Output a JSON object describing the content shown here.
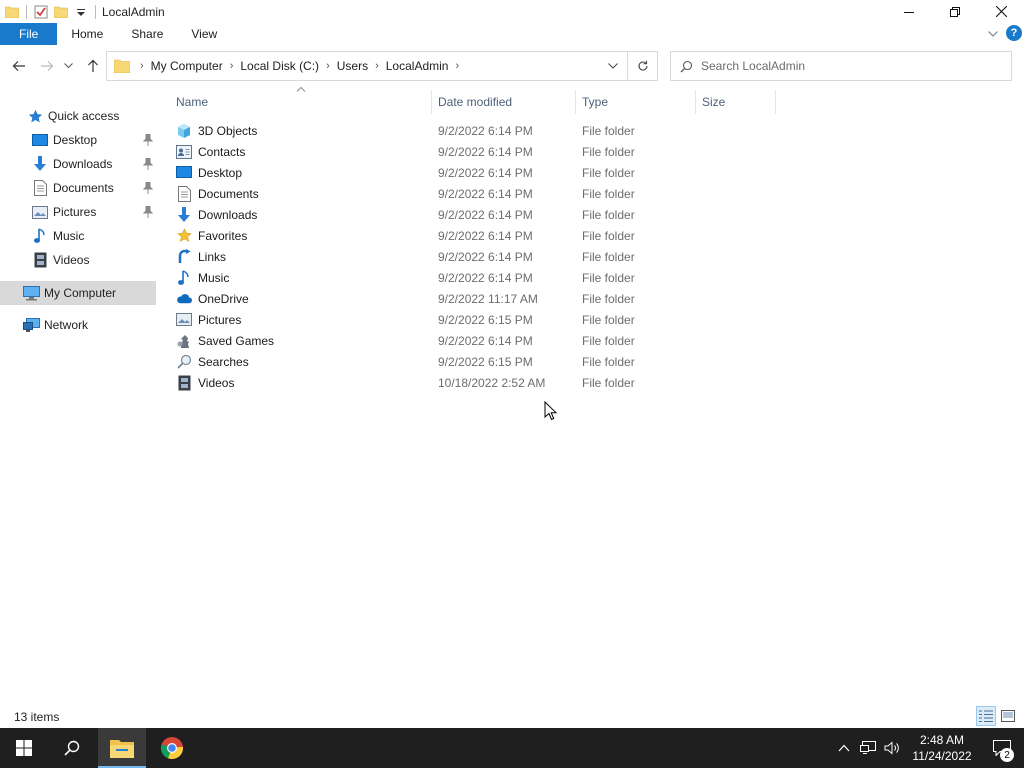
{
  "window": {
    "title": "LocalAdmin"
  },
  "ribbon": {
    "tabs": [
      "File",
      "Home",
      "Share",
      "View"
    ]
  },
  "address": {
    "crumbs": [
      "My Computer",
      "Local Disk (C:)",
      "Users",
      "LocalAdmin"
    ]
  },
  "search": {
    "placeholder": "Search LocalAdmin"
  },
  "sidebar": {
    "items": [
      {
        "label": "Quick access",
        "icon": "star-icon"
      },
      {
        "label": "Desktop",
        "icon": "desktop-icon",
        "pinned": true
      },
      {
        "label": "Downloads",
        "icon": "download-arrow-icon",
        "pinned": true
      },
      {
        "label": "Documents",
        "icon": "document-icon",
        "pinned": true
      },
      {
        "label": "Pictures",
        "icon": "pictures-icon",
        "pinned": true
      },
      {
        "label": "Music",
        "icon": "music-note-icon"
      },
      {
        "label": "Videos",
        "icon": "film-icon"
      },
      {
        "label": "My Computer",
        "icon": "computer-icon",
        "selected": true
      },
      {
        "label": "Network",
        "icon": "network-icon"
      }
    ]
  },
  "columns": {
    "name": "Name",
    "date": "Date modified",
    "type": "Type",
    "size": "Size"
  },
  "files": [
    {
      "name": "3D Objects",
      "date": "9/2/2022 6:14 PM",
      "type": "File folder",
      "icon": "cube-icon"
    },
    {
      "name": "Contacts",
      "date": "9/2/2022 6:14 PM",
      "type": "File folder",
      "icon": "contacts-icon"
    },
    {
      "name": "Desktop",
      "date": "9/2/2022 6:14 PM",
      "type": "File folder",
      "icon": "desktop-icon"
    },
    {
      "name": "Documents",
      "date": "9/2/2022 6:14 PM",
      "type": "File folder",
      "icon": "document-icon"
    },
    {
      "name": "Downloads",
      "date": "9/2/2022 6:14 PM",
      "type": "File folder",
      "icon": "download-arrow-icon"
    },
    {
      "name": "Favorites",
      "date": "9/2/2022 6:14 PM",
      "type": "File folder",
      "icon": "star-icon"
    },
    {
      "name": "Links",
      "date": "9/2/2022 6:14 PM",
      "type": "File folder",
      "icon": "link-arrow-icon"
    },
    {
      "name": "Music",
      "date": "9/2/2022 6:14 PM",
      "type": "File folder",
      "icon": "music-note-icon"
    },
    {
      "name": "OneDrive",
      "date": "9/2/2022 11:17 AM",
      "type": "File folder",
      "icon": "cloud-icon"
    },
    {
      "name": "Pictures",
      "date": "9/2/2022 6:15 PM",
      "type": "File folder",
      "icon": "pictures-icon"
    },
    {
      "name": "Saved Games",
      "date": "9/2/2022 6:14 PM",
      "type": "File folder",
      "icon": "chess-piece-icon"
    },
    {
      "name": "Searches",
      "date": "9/2/2022 6:15 PM",
      "type": "File folder",
      "icon": "magnifier-icon"
    },
    {
      "name": "Videos",
      "date": "10/18/2022 2:52 AM",
      "type": "File folder",
      "icon": "film-icon"
    }
  ],
  "status": {
    "item_count": "13 items"
  },
  "taskbar": {
    "time": "2:48 AM",
    "date": "11/24/2022",
    "notification_count": "2"
  },
  "colors": {
    "accent": "#1979ca",
    "taskbar": "#1f1f1f",
    "folder": "#f8d775",
    "selected_nav": "#d9d9d9"
  }
}
